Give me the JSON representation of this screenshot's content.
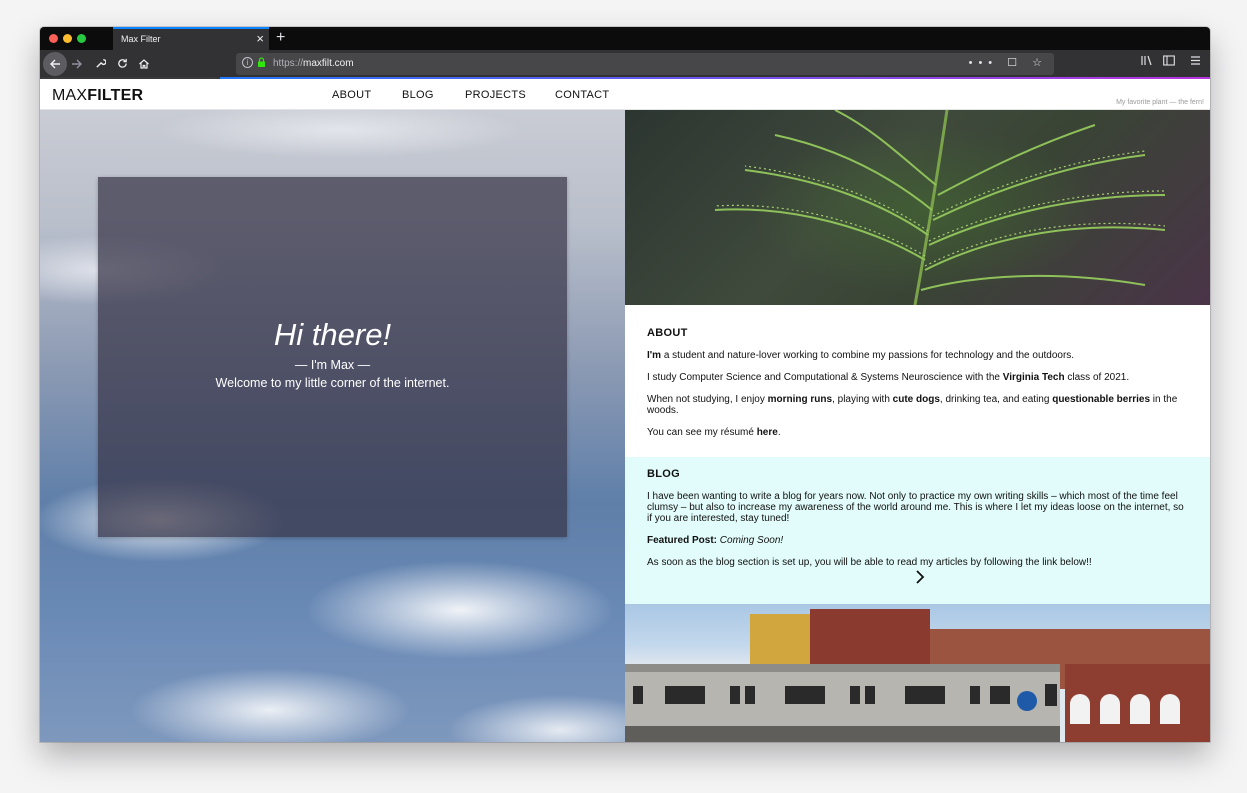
{
  "browser": {
    "tab_title": "Max Filter",
    "tab_close": "×",
    "new_tab": "+",
    "url_scheme": "https://",
    "url_host": "maxfilt.com",
    "url_actions": "••• ☐ ☆",
    "icons": [
      "back-arrow-icon",
      "forward-arrow-icon",
      "wrench-icon",
      "reload-icon",
      "home-icon",
      "info-icon",
      "lock-icon",
      "library-icon",
      "sidebar-icon",
      "menu-icon"
    ],
    "accent": "#0a84ff"
  },
  "site": {
    "logo_light": "MAX",
    "logo_bold": "FILTER",
    "nav": [
      "ABOUT",
      "BLOG",
      "PROJECTS",
      "CONTACT"
    ],
    "caption": "My favorite plant — the fern!"
  },
  "hero": {
    "title": "Hi there!",
    "subtitle": "— I'm Max —",
    "welcome": "Welcome to my little corner of the internet."
  },
  "about": {
    "title": "ABOUT",
    "p1_bold": "I'm",
    "p1_rest": " a student and nature-lover working to combine my passions for technology and the outdoors.",
    "p2_a": "I study Computer Science and Computational & Systems Neuroscience with the ",
    "p2_bold": "Virginia Tech",
    "p2_b": " class of 2021.",
    "p3_a": "When not studying, I enjoy ",
    "p3_b1": "morning runs",
    "p3_b": ", playing with ",
    "p3_b2": "cute dogs",
    "p3_c": ", drinking tea, and eating ",
    "p3_b3": "questionable berries",
    "p3_d": " in the woods.",
    "p4_a": "You can see my résumé ",
    "p4_link": "here",
    "p4_b": "."
  },
  "blog": {
    "title": "BLOG",
    "intro": "I have been wanting to write a blog for years now. Not only to practice my own writing skills – which most of the time feel clumsy – but also to increase my awareness of the world around me. This is where I let my ideas loose on the internet, so if you are interested, stay tuned!",
    "featured_label": "Featured Post:",
    "featured_value": "Coming Soon!",
    "note": "As soon as the blog section is set up, you will be able to read my articles by following the link below!!"
  },
  "colors": {
    "blog_bg": "#e1fcfa",
    "hero_card": "#373448"
  }
}
